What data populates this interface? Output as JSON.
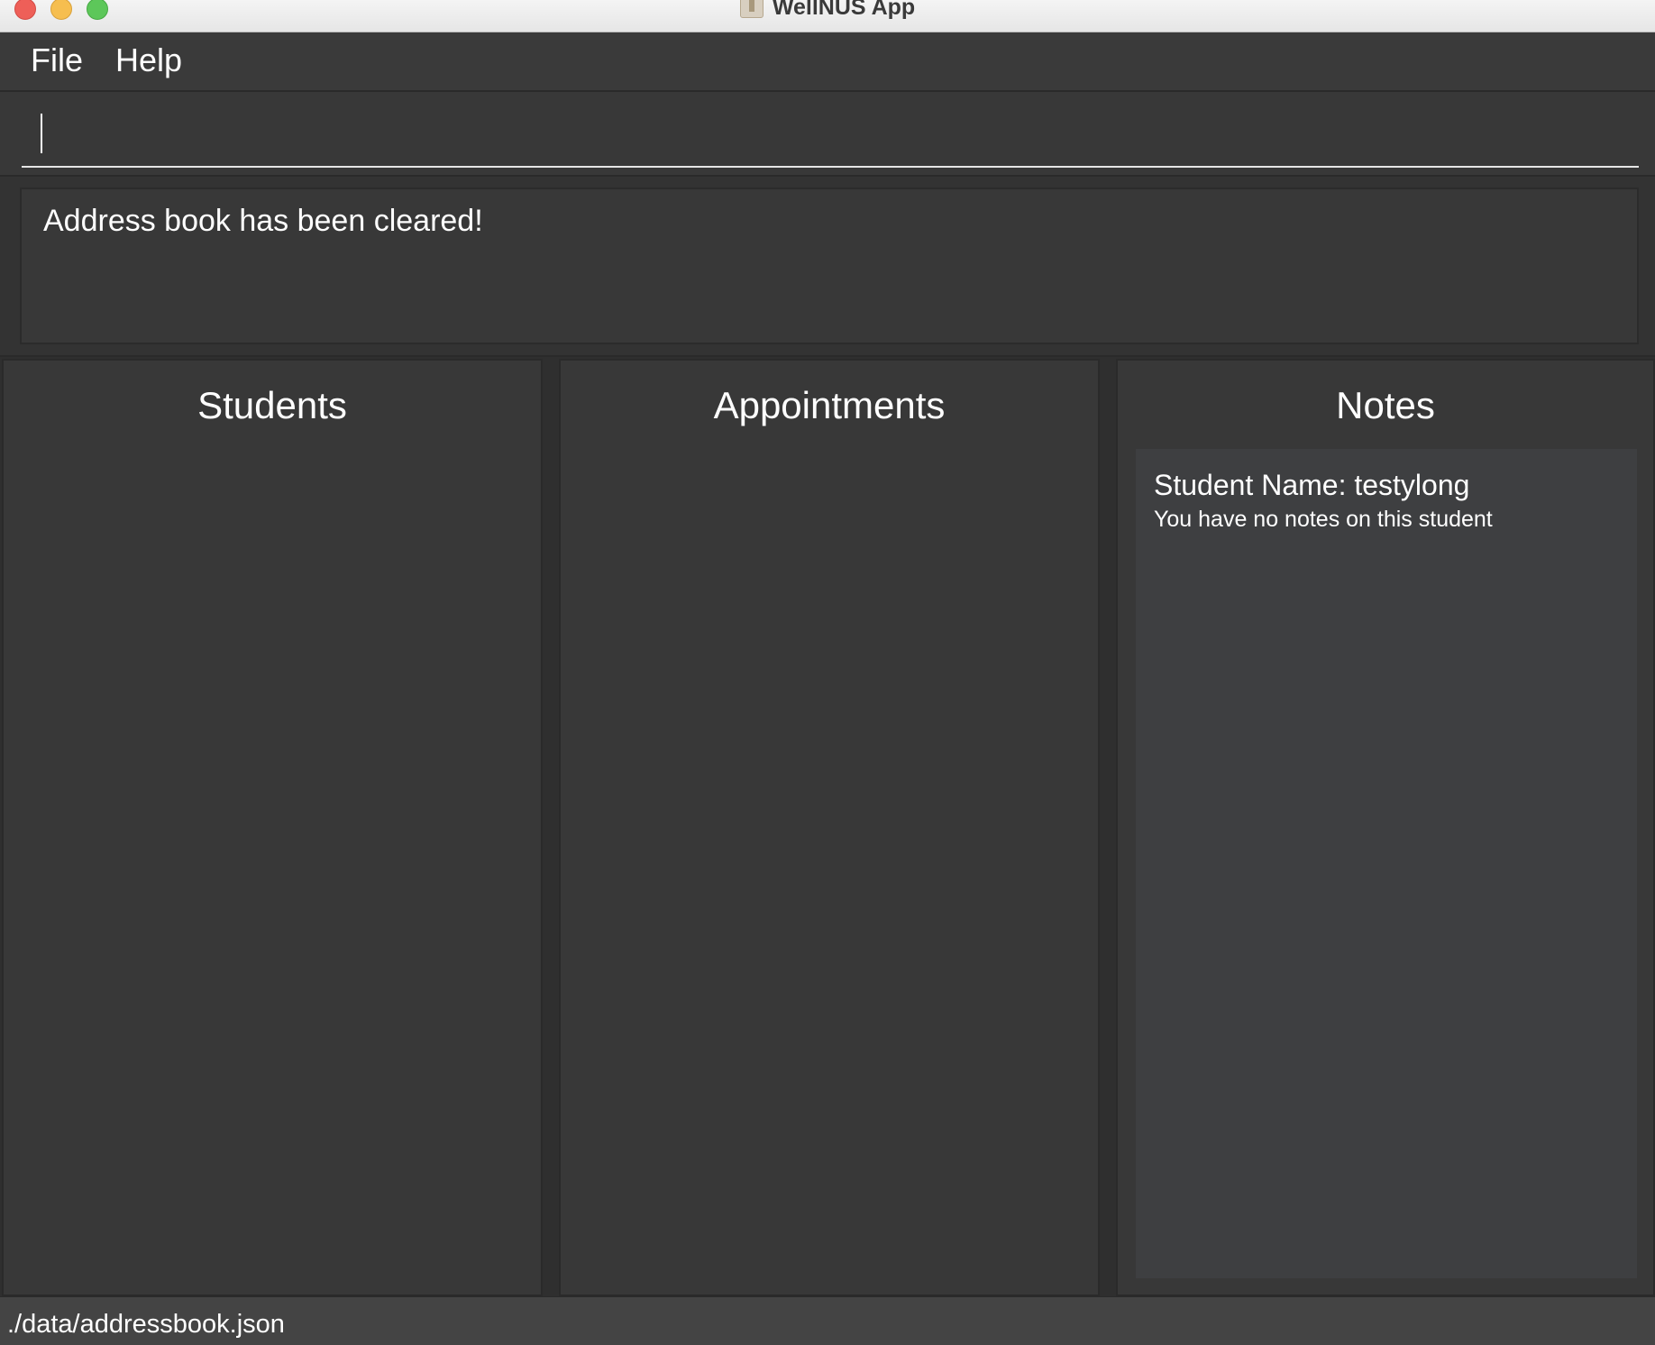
{
  "window": {
    "title": "WellNUS App"
  },
  "menu": {
    "file_label": "File",
    "help_label": "Help"
  },
  "command": {
    "value": ""
  },
  "result": {
    "message": "Address book has been cleared!"
  },
  "panels": {
    "students_title": "Students",
    "appointments_title": "Appointments",
    "notes_title": "Notes"
  },
  "notes": {
    "student_name": "Student Name: testylong",
    "message": "You have no notes on this student"
  },
  "status": {
    "file_path": "./data/addressbook.json"
  }
}
